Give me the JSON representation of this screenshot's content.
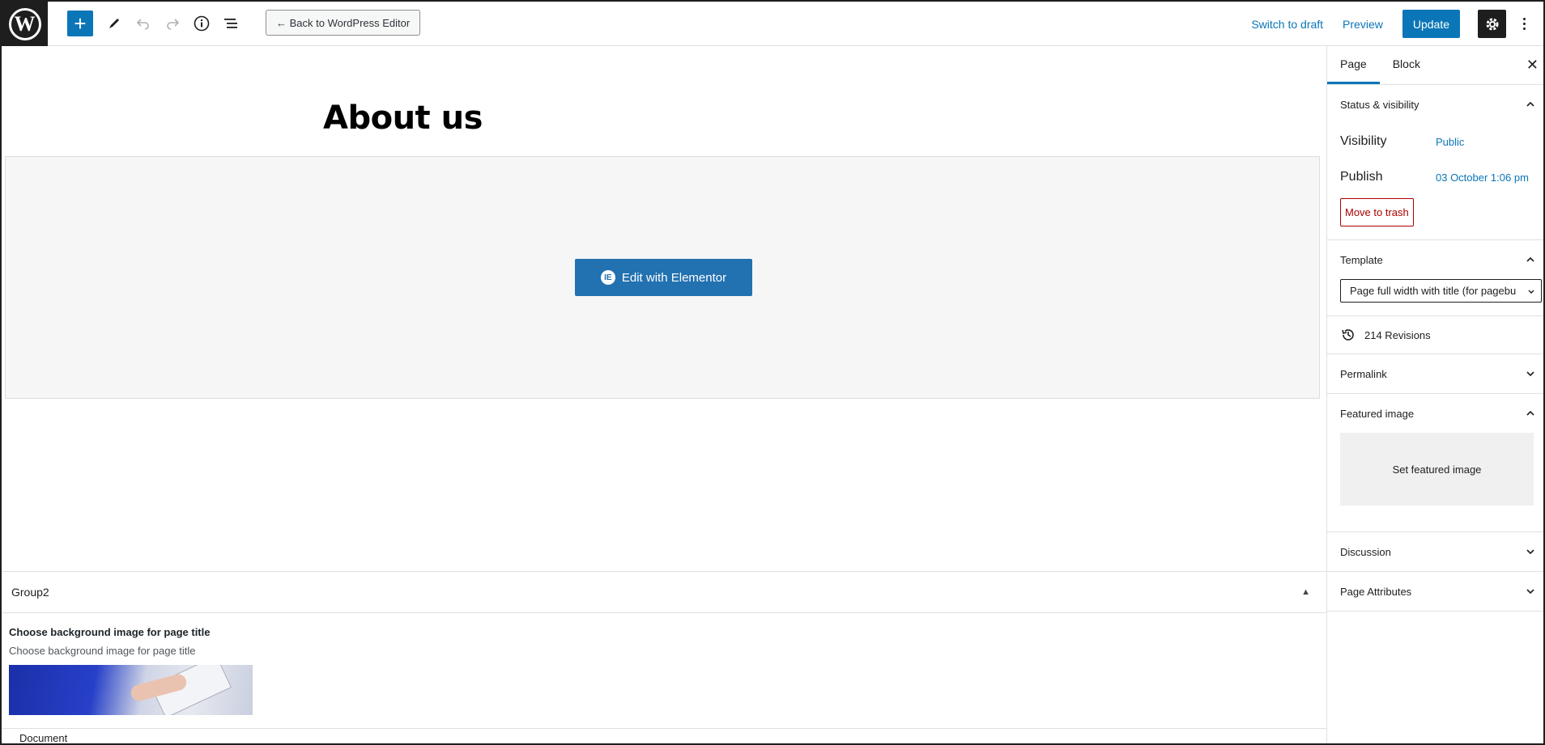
{
  "topbar": {
    "logo_letter": "W",
    "back_label": "← Back to WordPress Editor",
    "switch_draft_label": "Switch to draft",
    "preview_label": "Preview",
    "update_label": "Update",
    "add_symbol": "+"
  },
  "editor": {
    "page_title": "About us",
    "elementor_button_label": "Edit with Elementor",
    "elementor_logo": "IE"
  },
  "metabox": {
    "group_title": "Group2",
    "field_label": "Choose background image for page title",
    "field_description": "Choose background image for page title"
  },
  "footer": {
    "breadcrumb": "Document"
  },
  "sidebar": {
    "tabs": [
      {
        "label": "Page",
        "active": true
      },
      {
        "label": "Block",
        "active": false
      }
    ],
    "status": {
      "title": "Status & visibility",
      "visibility_label": "Visibility",
      "visibility_value": "Public",
      "publish_label": "Publish",
      "publish_value": "03 October 1:06 pm",
      "trash_label": "Move to trash"
    },
    "template": {
      "title": "Template",
      "selected": "Page full width with title (for pagebu"
    },
    "revisions_label": "214 Revisions",
    "permalink_title": "Permalink",
    "featured": {
      "title": "Featured image",
      "set_label": "Set featured image"
    },
    "discussion_title": "Discussion",
    "page_attributes_title": "Page Attributes"
  },
  "colors": {
    "accent": "#0b76b7",
    "dark": "#1e1e1e",
    "danger": "#aa0000",
    "elementor_blue": "#2271b1"
  },
  "icons": [
    "wordpress-logo-icon",
    "plus-icon",
    "pencil-icon",
    "undo-icon",
    "redo-icon",
    "info-icon",
    "list-view-icon",
    "gear-icon",
    "more-vertical-icon",
    "close-icon",
    "chevron-up-icon",
    "chevron-down-icon",
    "history-icon",
    "elementor-icon",
    "triangle-up-icon"
  ]
}
